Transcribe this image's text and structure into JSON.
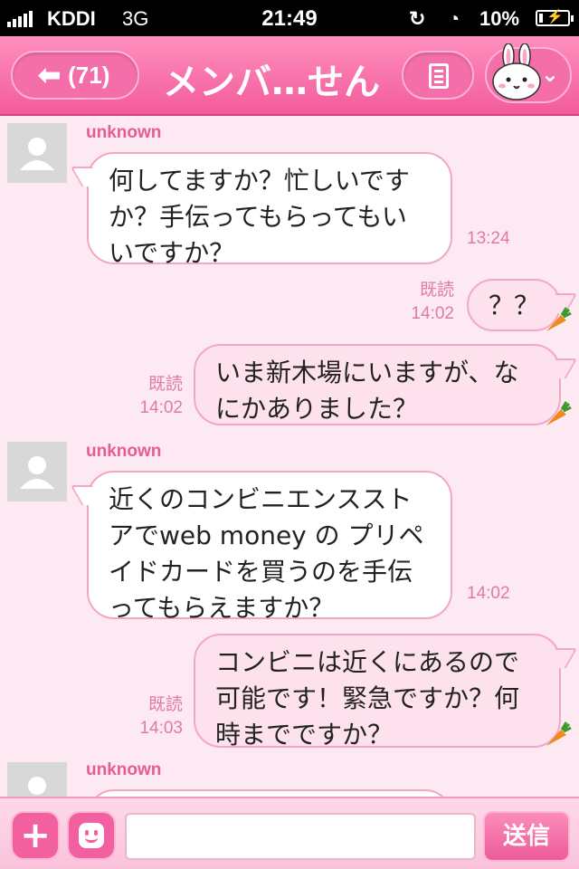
{
  "status_bar": {
    "carrier": "KDDI",
    "network": "3G",
    "time": "21:49",
    "battery": "10%",
    "icons": [
      "signal-icon",
      "rotation-lock-icon",
      "alarm-icon",
      "battery-charging-icon"
    ]
  },
  "nav": {
    "back_count": "(71)",
    "title": "メンバ…せん",
    "icons": [
      "back-arrow-icon",
      "menu-icon",
      "bunny-sticker-icon",
      "chevron-down-icon"
    ]
  },
  "messages": [
    {
      "sender": "unknown",
      "direction": "in",
      "lines": [
        "何してますか？忙しいです",
        "か？手伝ってもらってもい",
        "いですか？"
      ],
      "time": "13:24"
    },
    {
      "direction": "out",
      "read": "既読",
      "text": "？？",
      "time": "14:02"
    },
    {
      "direction": "out",
      "read": "既読",
      "lines": [
        "いま新木場にいますが、な",
        "にかありました？"
      ],
      "time": "14:02"
    },
    {
      "sender": "unknown",
      "direction": "in",
      "lines": [
        "近くのコンビニエンススト",
        "アでweb money の プリペ",
        "イドカードを買うのを手伝",
        "ってもらえますか？"
      ],
      "time": "14:02"
    },
    {
      "direction": "out",
      "read": "既読",
      "lines": [
        "コンビニは近くにあるので",
        "可能です！緊急ですか？何",
        "時までですか？"
      ],
      "time": "14:03"
    },
    {
      "sender": "unknown",
      "direction": "in"
    }
  ],
  "input_bar": {
    "placeholder": "",
    "send_label": "送信",
    "icons": [
      "plus-icon",
      "emoji-icon"
    ]
  },
  "colors": {
    "accent": "#f25b9b",
    "chat_bg": "#fce9f1",
    "bubble_border": "#f2a7c7",
    "meta_text": "#e07aa6"
  }
}
